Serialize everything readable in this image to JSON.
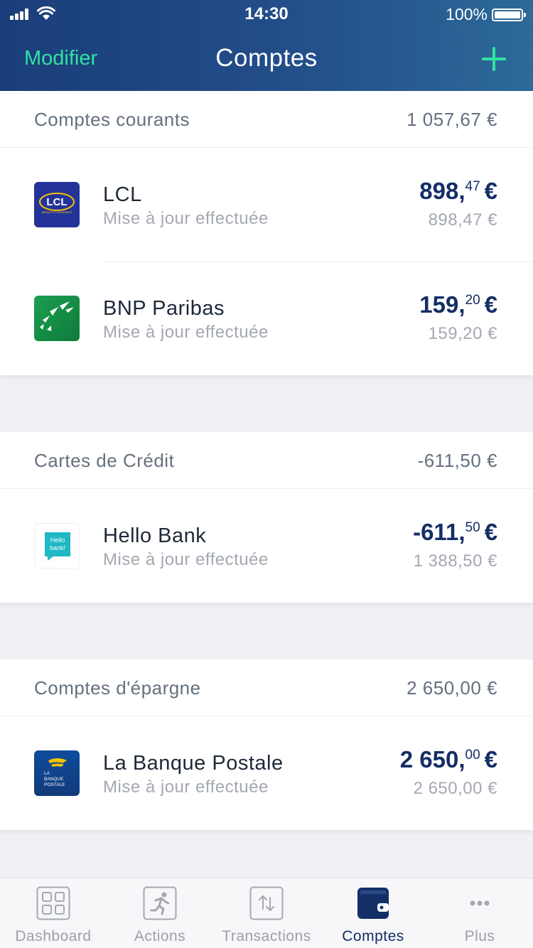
{
  "status_bar": {
    "time": "14:30",
    "battery": "100%"
  },
  "nav": {
    "left_label": "Modifier",
    "title": "Comptes",
    "add_icon": "plus-icon",
    "accent_color": "#2fe3a0"
  },
  "sections": [
    {
      "title": "Comptes courants",
      "total": "1 057,67 €",
      "accounts": [
        {
          "name": "LCL",
          "status": "Mise à jour effectuée",
          "amount_int": "898,",
          "amount_dec": "47",
          "currency": "€",
          "sub_amount": "898,47 €",
          "logo_text": "LCL",
          "logo_sub": "BANQUE ET ASSURANCE"
        },
        {
          "name": "BNP Paribas",
          "status": "Mise à jour effectuée",
          "amount_int": "159,",
          "amount_dec": "20",
          "currency": "€",
          "sub_amount": "159,20 €"
        }
      ]
    },
    {
      "title": "Cartes de Crédit",
      "total": "-611,50 €",
      "accounts": [
        {
          "name": "Hello Bank",
          "status": "Mise à jour effectuée",
          "amount_int": "-611,",
          "amount_dec": "50",
          "currency": "€",
          "sub_amount": "1 388,50 €",
          "logo_text": "Hello bank!"
        }
      ]
    },
    {
      "title": "Comptes d'épargne",
      "total": "2 650,00 €",
      "accounts": [
        {
          "name": "La Banque Postale",
          "status": "Mise à jour effectuée",
          "amount_int": "2 650,",
          "amount_dec": "00",
          "currency": "€",
          "sub_amount": "2 650,00 €",
          "logo_line1": "LA",
          "logo_line2": "BANQUE",
          "logo_line3": "POSTALE"
        }
      ]
    }
  ],
  "tabs": [
    {
      "label": "Dashboard",
      "icon": "dashboard-grid-icon",
      "active": false
    },
    {
      "label": "Actions",
      "icon": "running-person-icon",
      "active": false
    },
    {
      "label": "Transactions",
      "icon": "transfer-arrows-icon",
      "active": false
    },
    {
      "label": "Comptes",
      "icon": "wallet-icon",
      "active": true
    },
    {
      "label": "Plus",
      "icon": "more-dots-icon",
      "active": false
    }
  ]
}
